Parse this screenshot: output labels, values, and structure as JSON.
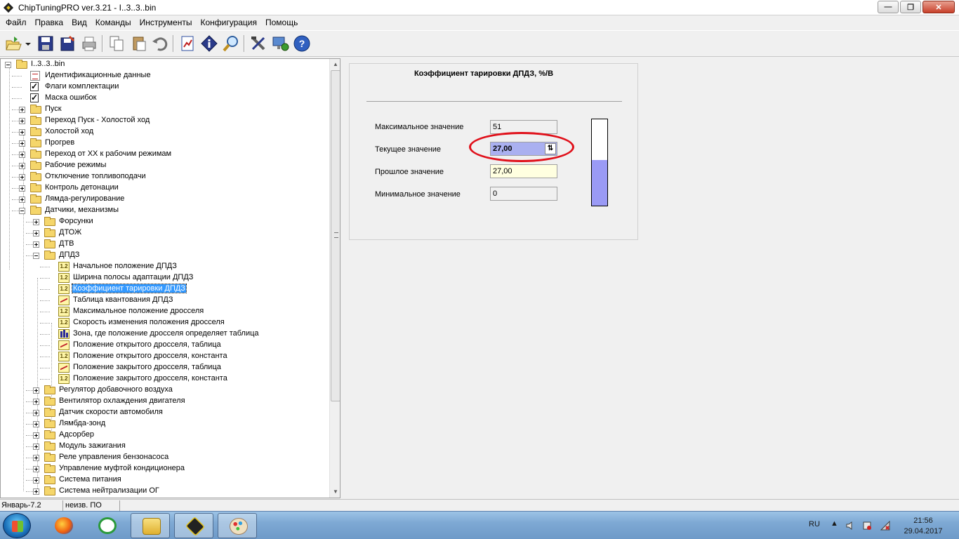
{
  "window": {
    "title": "ChipTuningPRO ver.3.21 - I..3..3..bin",
    "minimize": "—",
    "restore": "❐",
    "close": "✕"
  },
  "menu": [
    "Файл",
    "Правка",
    "Вид",
    "Команды",
    "Инструменты",
    "Конфигурация",
    "Помощь"
  ],
  "toolbar": {
    "icons": [
      "open-icon",
      "dropdown-arrow-icon",
      "save-icon",
      "save-as-icon",
      "print-icon",
      "copy-icon",
      "paste-icon",
      "undo-icon",
      "report-icon",
      "info-icon",
      "search-icon",
      "tools-icon",
      "connect-icon",
      "help-icon"
    ]
  },
  "tree": {
    "root": "I..3..3..bin",
    "items": [
      {
        "label": "Идентификационные данные",
        "icon": "id-icon"
      },
      {
        "label": "Флаги комплектации",
        "icon": "checkbox-icon"
      },
      {
        "label": "Маска ошибок",
        "icon": "checkbox-icon"
      },
      {
        "label": "Пуск",
        "icon": "folder-icon"
      },
      {
        "label": "Переход Пуск - Холостой ход",
        "icon": "folder-icon"
      },
      {
        "label": "Холостой ход",
        "icon": "folder-icon"
      },
      {
        "label": "Прогрев",
        "icon": "folder-icon"
      },
      {
        "label": "Переход от ХХ к рабочим режимам",
        "icon": "folder-icon"
      },
      {
        "label": "Рабочие режимы",
        "icon": "folder-icon"
      },
      {
        "label": "Отключение топливоподачи",
        "icon": "folder-icon"
      },
      {
        "label": "Контроль детонации",
        "icon": "folder-icon"
      },
      {
        "label": "Лямда-регулирование",
        "icon": "folder-icon"
      },
      {
        "label": "Датчики, механизмы",
        "icon": "open-folder-icon"
      }
    ],
    "sensors": [
      {
        "label": "Форсунки",
        "icon": "folder-icon"
      },
      {
        "label": "ДТОЖ",
        "icon": "folder-icon"
      },
      {
        "label": "ДТВ",
        "icon": "folder-icon"
      },
      {
        "label": "ДПДЗ",
        "icon": "open-folder-icon"
      }
    ],
    "dpdz": [
      {
        "label": "Начальное положение ДПДЗ",
        "icon": "number-icon",
        "badge": "1.2"
      },
      {
        "label": "Ширина полосы адаптации ДПДЗ",
        "icon": "number-icon",
        "badge": "1.2"
      },
      {
        "label": "Коэффициент тарировки ДПДЗ",
        "icon": "number-icon",
        "badge": "1.2"
      },
      {
        "label": "Таблица квантования ДПДЗ",
        "icon": "table-chart-icon"
      },
      {
        "label": "Максимальное положение дросселя",
        "icon": "number-icon",
        "badge": "1.2"
      },
      {
        "label": "Скорость изменения положения дросселя",
        "icon": "number-icon",
        "badge": "1.2"
      },
      {
        "label": "Зона, где положение дросселя определяет таблица",
        "icon": "bar-chart-icon"
      },
      {
        "label": "Положение открытого дросселя, таблица",
        "icon": "table-chart-icon"
      },
      {
        "label": "Положение открытого дросселя, константа",
        "icon": "number-icon",
        "badge": "1.2"
      },
      {
        "label": "Положение закрытого дросселя, таблица",
        "icon": "table-chart-icon"
      },
      {
        "label": "Положение закрытого дросселя, константа",
        "icon": "number-icon",
        "badge": "1.2"
      }
    ],
    "more": [
      {
        "label": "Регулятор добавочного воздуха",
        "icon": "folder-icon"
      },
      {
        "label": "Вентилятор охлаждения двигателя",
        "icon": "folder-icon"
      },
      {
        "label": "Датчик скорости автомобиля",
        "icon": "folder-icon"
      },
      {
        "label": "Лямбда-зонд",
        "icon": "folder-icon"
      },
      {
        "label": "Адсорбер",
        "icon": "folder-icon"
      },
      {
        "label": "Модуль зажигания",
        "icon": "folder-icon"
      },
      {
        "label": "Реле управления бензонасоса",
        "icon": "folder-icon"
      },
      {
        "label": "Управление муфтой кондиционера",
        "icon": "folder-icon"
      },
      {
        "label": "Система питания",
        "icon": "folder-icon"
      },
      {
        "label": "Система нейтрализации ОГ",
        "icon": "folder-icon"
      }
    ]
  },
  "detail": {
    "title": "Коэффициент тарировки ДПДЗ, %/В",
    "max_label": "Максимальное значение",
    "max_value": "51",
    "current_label": "Текущее значение",
    "current_value": "27,00",
    "past_label": "Прошлое значение",
    "past_value": "27,00",
    "min_label": "Минимальное значение",
    "min_value": "0",
    "gauge_fraction": 0.53,
    "gauge_color": "#9a9af5",
    "highlight_color": "#e0101a"
  },
  "status": {
    "firmware": "Январь-7.2",
    "software": "неизв. ПО"
  },
  "taskbar": {
    "apps": [
      "firefox-icon",
      "network-monitor-icon",
      "file-explorer-icon",
      "chiptuningpro-icon",
      "paint-icon"
    ],
    "language": "RU",
    "time": "21:56",
    "date": "29.04.2017"
  }
}
